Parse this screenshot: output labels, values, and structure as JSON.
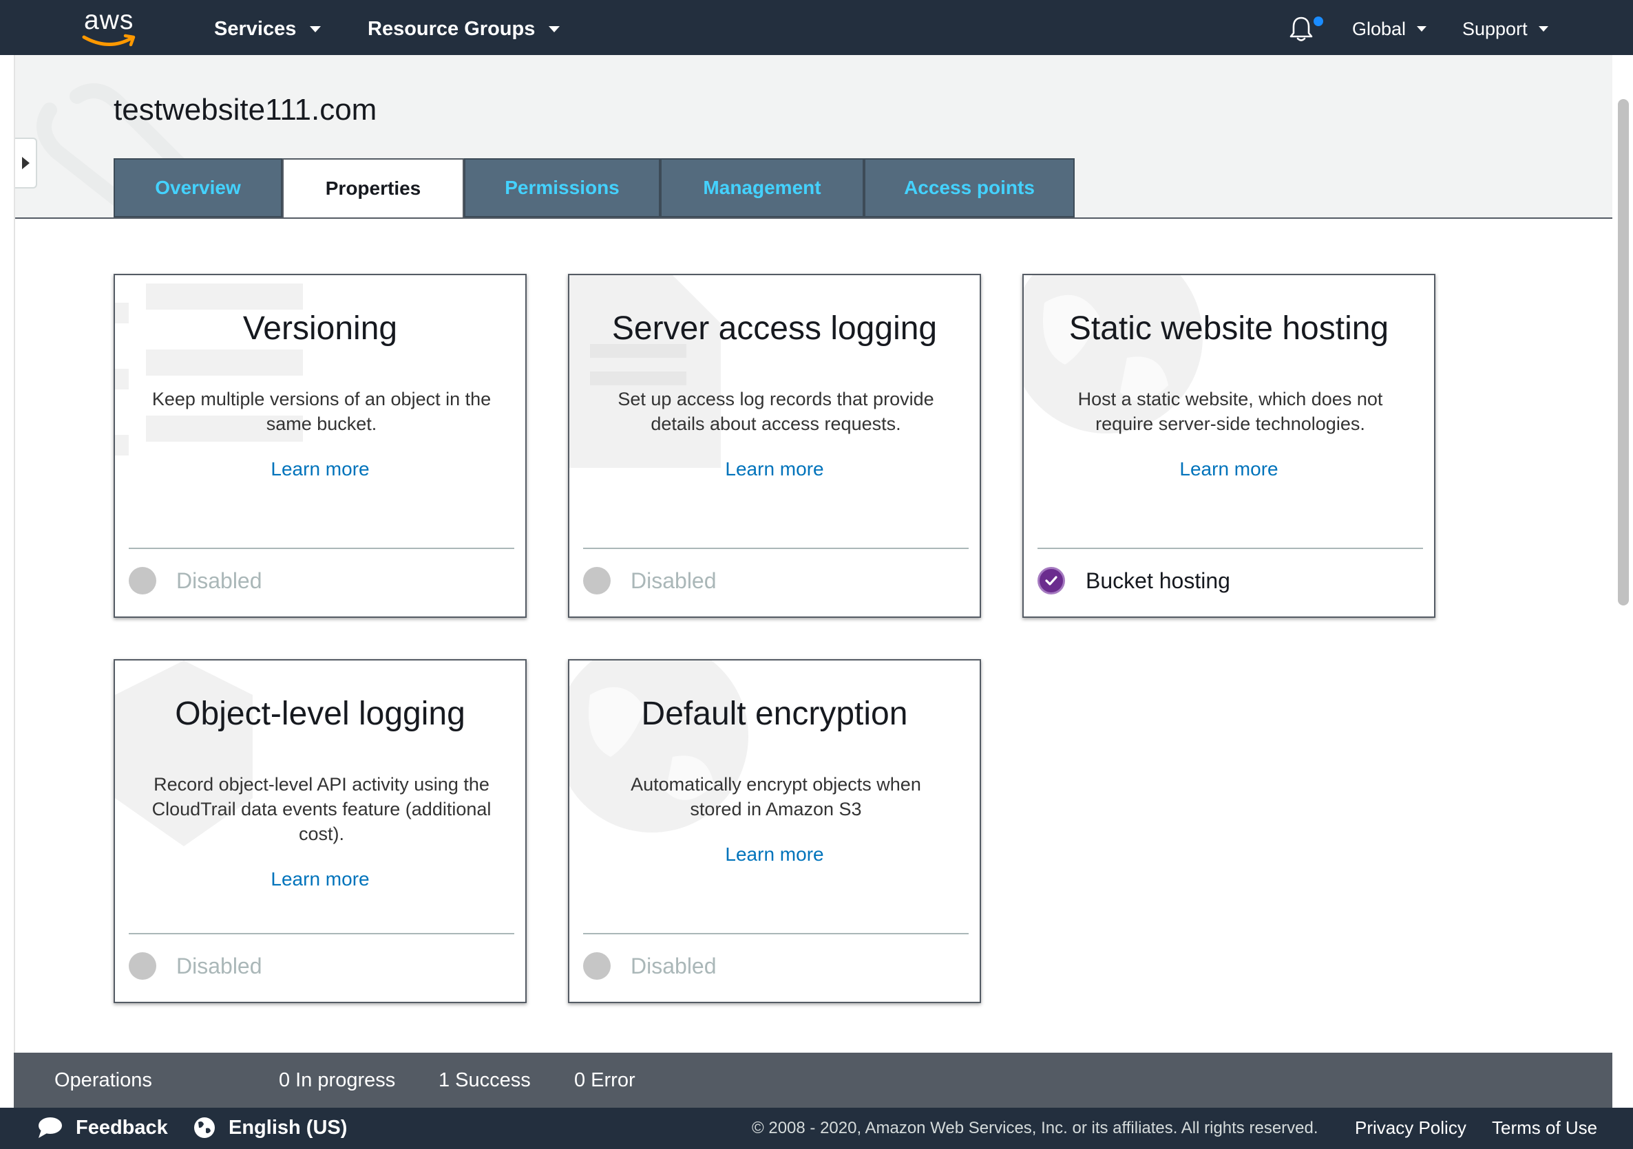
{
  "topnav": {
    "logo_text": "aws",
    "services_label": "Services",
    "resource_groups_label": "Resource Groups",
    "region_label": "Global",
    "support_label": "Support"
  },
  "page": {
    "title": "testwebsite111.com"
  },
  "tabs": [
    {
      "label": "Overview",
      "active": false
    },
    {
      "label": "Properties",
      "active": true
    },
    {
      "label": "Permissions",
      "active": false
    },
    {
      "label": "Management",
      "active": false
    },
    {
      "label": "Access points",
      "active": false
    }
  ],
  "cards": {
    "versioning": {
      "title": "Versioning",
      "description": "Keep multiple versions of an object in the same bucket.",
      "link": "Learn more",
      "status": "Disabled"
    },
    "server_access_logging": {
      "title": "Server access logging",
      "description": "Set up access log records that provide details about access requests.",
      "link": "Learn more",
      "status": "Disabled"
    },
    "static_website_hosting": {
      "title": "Static website hosting",
      "description": "Host a static website, which does not require server-side technologies.",
      "link": "Learn more",
      "status": "Bucket hosting"
    },
    "object_level_logging": {
      "title": "Object-level logging",
      "description": "Record object-level API activity using the CloudTrail data events feature (additional cost).",
      "link": "Learn more",
      "status": "Disabled"
    },
    "default_encryption": {
      "title": "Default encryption",
      "description": "Automatically encrypt objects when stored in Amazon S3",
      "link": "Learn more",
      "status": "Disabled"
    }
  },
  "operations": {
    "label": "Operations",
    "in_progress": "0 In progress",
    "success": "1 Success",
    "error": "0 Error"
  },
  "footer": {
    "feedback": "Feedback",
    "language": "English (US)",
    "copyright": "© 2008 - 2020, Amazon Web Services, Inc. or its affiliates. All rights reserved.",
    "privacy": "Privacy Policy",
    "terms": "Terms of Use"
  },
  "colors": {
    "nav_bg": "#232f3e",
    "tab_bg": "#546b7e",
    "tab_text": "#44d2ff",
    "link": "#0073bb",
    "enabled_status": "#6b2c8e",
    "ops_bg": "#545b64"
  }
}
